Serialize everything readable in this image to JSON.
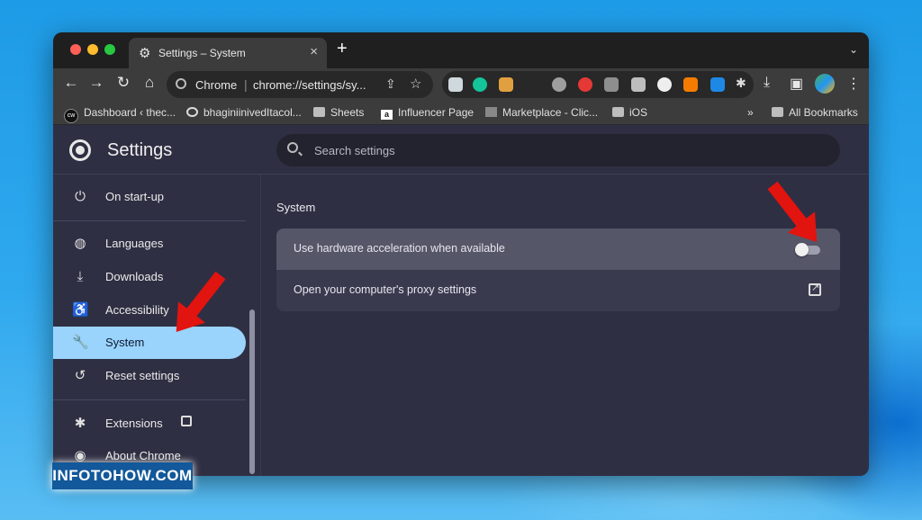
{
  "browser": {
    "tab_title": "Settings – System",
    "new_tab": "+",
    "toolbar": {
      "site_label": "Chrome",
      "separator": "|",
      "url": "chrome://settings/sy..."
    },
    "bookmarks": [
      {
        "label": "Dashboard ‹ thec..."
      },
      {
        "label": "bhaginiinivedItacol..."
      },
      {
        "label": "Sheets"
      },
      {
        "label": "Influencer Page"
      },
      {
        "label": "Marketplace - Clic..."
      },
      {
        "label": "iOS"
      },
      {
        "label": "»"
      },
      {
        "label": "All Bookmarks"
      }
    ]
  },
  "settings": {
    "title": "Settings",
    "search_placeholder": "Search settings",
    "sidebar": [
      {
        "label": "On start-up",
        "icon": "power-icon"
      },
      {
        "label": "Languages",
        "icon": "globe-icon"
      },
      {
        "label": "Downloads",
        "icon": "download-icon"
      },
      {
        "label": "Accessibility",
        "icon": "accessibility-icon"
      },
      {
        "label": "System",
        "icon": "wrench-icon",
        "active": true
      },
      {
        "label": "Reset settings",
        "icon": "history-icon"
      },
      {
        "label": "Extensions",
        "icon": "puzzle-icon"
      },
      {
        "label": "About Chrome",
        "icon": "chrome-icon"
      }
    ],
    "section_title": "System",
    "rows": [
      {
        "label": "Use hardware acceleration when available",
        "toggle": false
      },
      {
        "label": "Open your computer's proxy settings"
      }
    ]
  },
  "watermark": "INFOTOHOW.COM",
  "colors": {
    "accent_active": "#9ad3fb",
    "arrow": "#e1140f",
    "background": "#2f2f43"
  }
}
